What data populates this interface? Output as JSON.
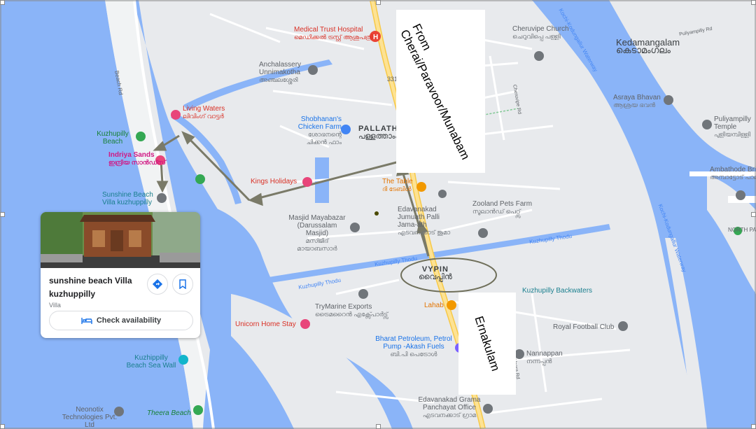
{
  "labels": {
    "medical_trust": "Medical Trust Hospital",
    "medical_trust_ml": "മെഡിക്കൽ ട്രസ്റ്റ് ആശുപത്രി",
    "cheruvipe": "Cheruvipe Church",
    "cheruvipe_ml": "ചെറുവിപ്പെ പള്ളി",
    "kedamangalam": "Kedamangalam",
    "kedamangalam_ml": "കെടാമംഗലം",
    "anchalassery": "Anchalassery Unnimakotha",
    "anchalassery_ml": "അഞ്ചലശ്ശേരി",
    "living_waters": "Living Waters",
    "living_waters_ml": "ലിവിംഗ് വാട്ടർ",
    "shobhanans": "Shobhanan's Chicken Farm",
    "shobhanans_ml": "ശോഭനന്റെ ചിക്കൻ ഫാം",
    "pallathamkulam": "PALLATHAMKULAM",
    "pallathamkulam_ml": "പള്ളത്താംകുളം",
    "asraya": "Asraya Bhavan",
    "asraya_ml": "ആശ്രയ ഭവൻ",
    "puliyampilly": "Puliyampilly Temple",
    "puliyampilly_ml": "പുളിയമ്പിള്ളി",
    "kuzhupilly_beach": "Kuzhupilly Beach",
    "indriya_sands": "Indriya Sands",
    "indriya_sands_ml": "ഇന്ദ്രിയ സാൻഡ്സ്",
    "kings_holidays": "Kings Holidays",
    "the_table": "The Table",
    "the_table_ml": "ദി ടേബിൾ",
    "ambathode": "Ambathode Bridge",
    "ambathode_ml": "അമ്പാട്ടോട് പാലം",
    "sunshine_map": "Sunshine Beach Villa kuzhuppilly",
    "zooland": "Zooland Pets Farm",
    "zooland_ml": "സൂലാൻഡ് പെറ്റ്സ്",
    "edavanakad_juma": "Edavanakad Jumuath Palli Jama-ath",
    "edavanakad_juma_ml": "എടവനക്കാട് ജുമാ",
    "masjid": "Masjid Mayabazar (Darussalam Masjid)",
    "masjid_ml": "മസ്ജിദ് മായാബസാർ",
    "north_pa": "NORTH PA",
    "vypin": "VYPIN",
    "vypin_ml": "വൈപ്പിൻ",
    "kuzhupilly_backwaters": "Kuzhupilly Backwaters",
    "trymarine": "TryMarine Exports",
    "trymarine_ml": "ട്രൈമറൈൻ എക്സ്പോർട്സ്",
    "lahab": "Lahab",
    "unicorn": "Unicorn Home Stay",
    "royal": "Royal Football Club",
    "bharat": "Bharat Petroleum, Petrol Pump -Akash Fuels",
    "bharat_ml": "ബി.പി പെട്രോൾ",
    "nannappan": "Nannappan",
    "nannappan_ml": "നന്നപ്പൻ",
    "kuzhippilly_seawall": "Kuzhippilly Beach Sea Wall",
    "edavanakad_grama": "Edavanakad Grama Panchayat Office",
    "edavanakad_grama_ml": "എടവനക്കാട് ഗ്രാമ",
    "neonotix": "Neonotix Technologies Pvt. Ltd",
    "theera": "Theera Beach",
    "beach_rd": "Beach Rd",
    "cherupilly_rd": "Cheruvipe Rd",
    "veera_rd": "Veera Rd",
    "kuzhupilly_thodu": "Kuzhupilly Thodu",
    "kuzhupilly_thodu2": "Kuzhupilly Thodu",
    "puliyampilly_rd": "Puliyampilly Rd",
    "waterway": "Kochi-Kodungallur Waterway",
    "waterway2": "Kochi-Kodungallur Waterway",
    "road_331": "331"
  },
  "annotations": {
    "from": "From\nCherai/Paravoor/Munabam",
    "ernakulam": "Ernakulam"
  },
  "card": {
    "title": "sunshine beach Villa kuzhuppilly",
    "type": "Villa",
    "avail": "Check availability"
  },
  "colors": {
    "water": "#8ab4f8",
    "land": "#e8eaed",
    "highway": "#fde293",
    "arrow": "#7a7a68",
    "vypin_ellipse": "#6f6f5a"
  },
  "icons": [
    "hospital-icon",
    "church-icon",
    "temple-icon",
    "place-icon",
    "hotel-icon",
    "restaurant-icon",
    "mosque-icon",
    "park-icon",
    "fuel-icon",
    "directions-icon",
    "bookmark-icon",
    "bed-icon"
  ]
}
